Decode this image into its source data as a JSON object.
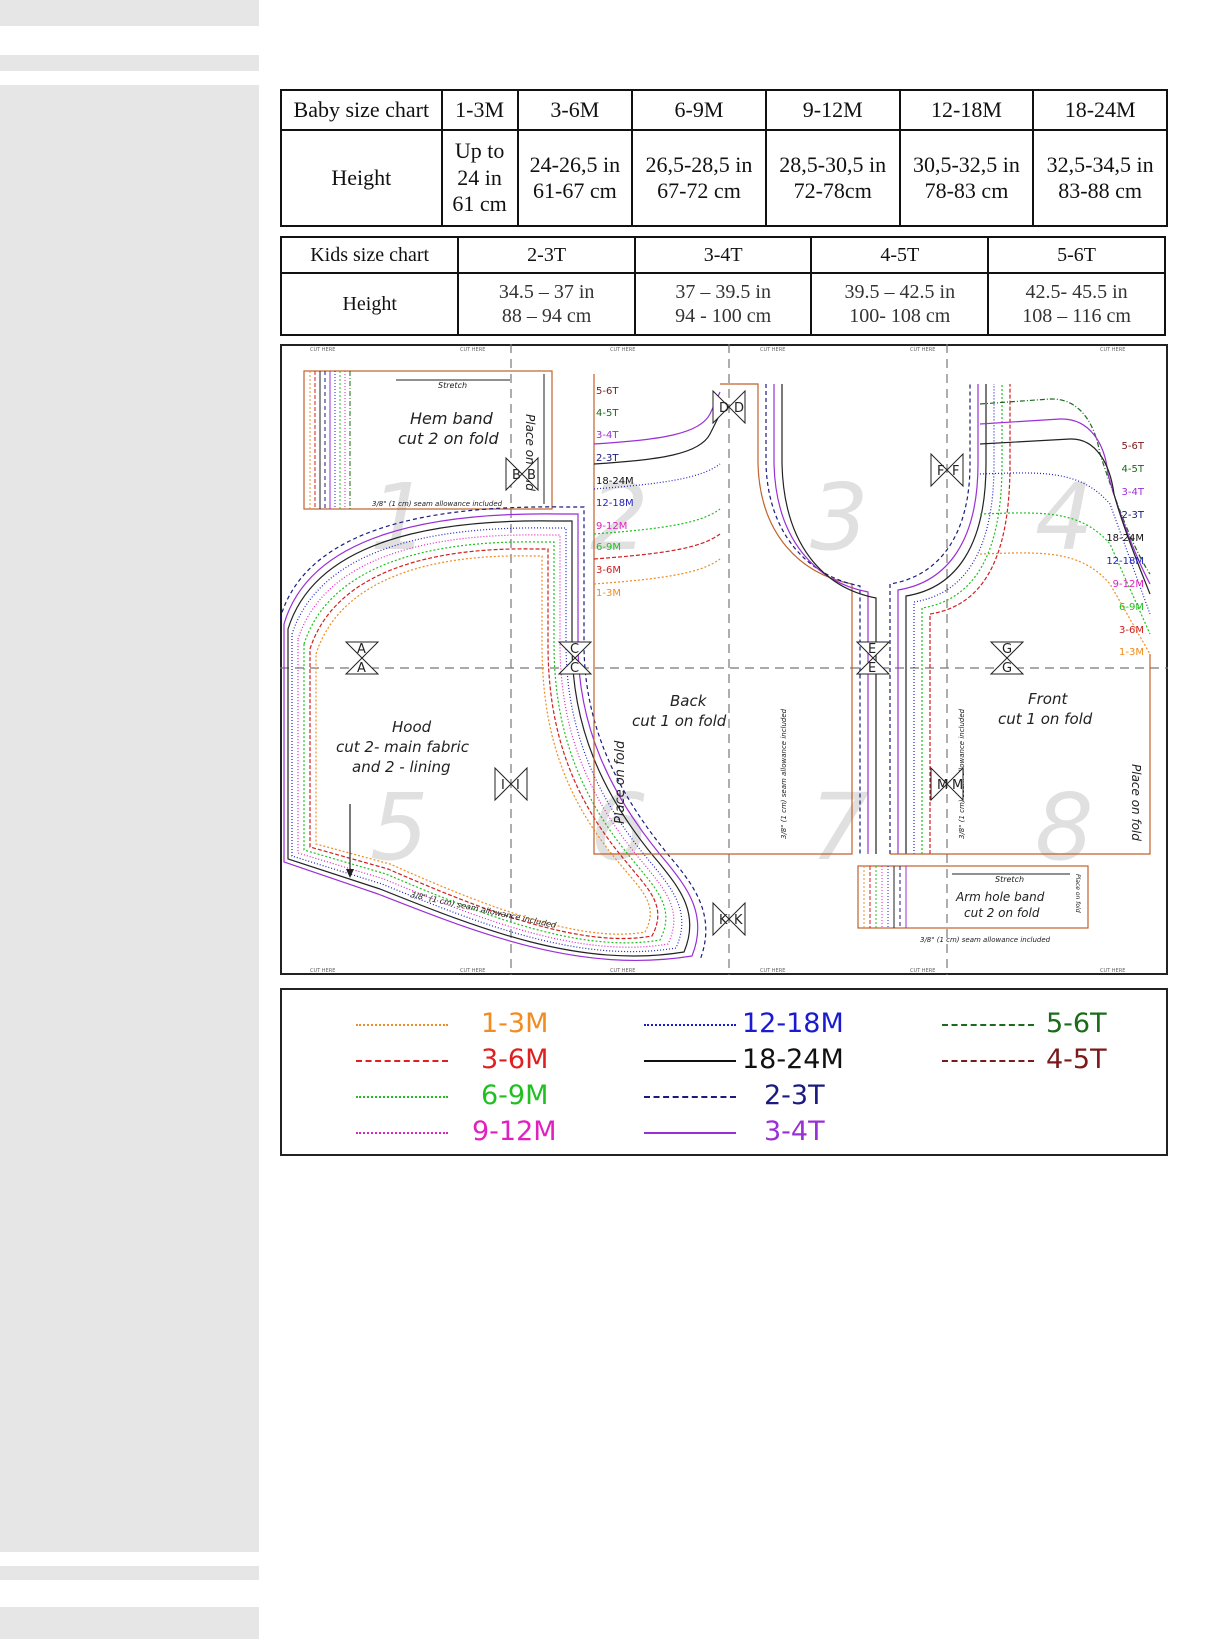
{
  "baby_chart": {
    "header_label": "Baby size chart",
    "sizes": [
      "1-3M",
      "3-6M",
      "6-9M",
      "9-12M",
      "12-18M",
      "18-24M"
    ],
    "row_label": "Height",
    "heights": [
      "Up to\n24 in\n61 cm",
      "24-26,5 in\n61-67 cm",
      "26,5-28,5 in\n67-72 cm",
      "28,5-30,5 in\n72-78cm",
      "30,5-32,5 in\n78-83 cm",
      "32,5-34,5 in\n83-88 cm"
    ]
  },
  "kids_chart": {
    "header_label": "Kids size chart",
    "sizes": [
      "2-3T",
      "3-4T",
      "4-5T",
      "5-6T"
    ],
    "row_label": "Height",
    "heights": [
      "34.5 – 37 in\n88 – 94 cm",
      "37 – 39.5 in\n94 - 100 cm",
      "39.5 – 42.5 in\n100- 108  cm",
      "42.5- 45.5 in\n108 – 116 cm"
    ]
  },
  "pattern": {
    "cut_here": "CUT HERE",
    "page_numbers": [
      "1",
      "2",
      "3",
      "4",
      "5",
      "6",
      "7",
      "8"
    ],
    "pieces": {
      "hem_band": {
        "name": "Hem band",
        "instruction": "cut 2 on fold",
        "stretch": "Stretch",
        "fold": "Place on fold"
      },
      "hood": {
        "name": "Hood",
        "instruction_1": "cut 2- main fabric",
        "instruction_2": "and 2 - lining"
      },
      "back": {
        "name": "Back",
        "instruction": "cut 1 on fold",
        "fold": "Place on fold"
      },
      "front": {
        "name": "Front",
        "instruction": "cut 1 on fold",
        "fold": "Place on fold"
      },
      "arm_hole_band": {
        "name": "Arm hole band",
        "instruction": "cut 2 on fold",
        "stretch": "Stretch",
        "fold": "Place on fold"
      }
    },
    "seam_allowance": "3/8\" (1 cm) seam allowance included",
    "markers": [
      "A",
      "B",
      "C",
      "D",
      "E",
      "F",
      "G",
      "I",
      "K",
      "M"
    ],
    "size_labels": [
      "5-6T",
      "4-5T",
      "3-4T",
      "2-3T",
      "18-24M",
      "12-18M",
      "9-12M",
      "6-9M",
      "3-6M",
      "1-3M"
    ],
    "size_colors": [
      "#1a6b1a",
      "#1a6b1a",
      "#9b2fd6",
      "#1a1a80",
      "#111111",
      "#2020c0",
      "#e020c0",
      "#20c020",
      "#d02020",
      "#f08c20"
    ]
  },
  "legend": [
    {
      "label": "1-3M",
      "color": "#f08c20",
      "style": "dotted"
    },
    {
      "label": "3-6M",
      "color": "#e02020",
      "style": "dashed"
    },
    {
      "label": "6-9M",
      "color": "#20c020",
      "style": "dotted"
    },
    {
      "label": "9-12M",
      "color": "#e020c0",
      "style": "dotted"
    },
    {
      "label": "12-18M",
      "color": "#1a1ad0",
      "style": "dotted"
    },
    {
      "label": "18-24M",
      "color": "#111111",
      "style": "solid"
    },
    {
      "label": "2-3T",
      "color": "#1a1a80",
      "style": "dashed"
    },
    {
      "label": "3-4T",
      "color": "#9b2fd6",
      "style": "solid"
    },
    {
      "label": "5-6T",
      "color": "#1a6b1a",
      "style": "dashdot"
    },
    {
      "label": "4-5T",
      "color": "#7a1a1a",
      "style": "dashed"
    }
  ]
}
